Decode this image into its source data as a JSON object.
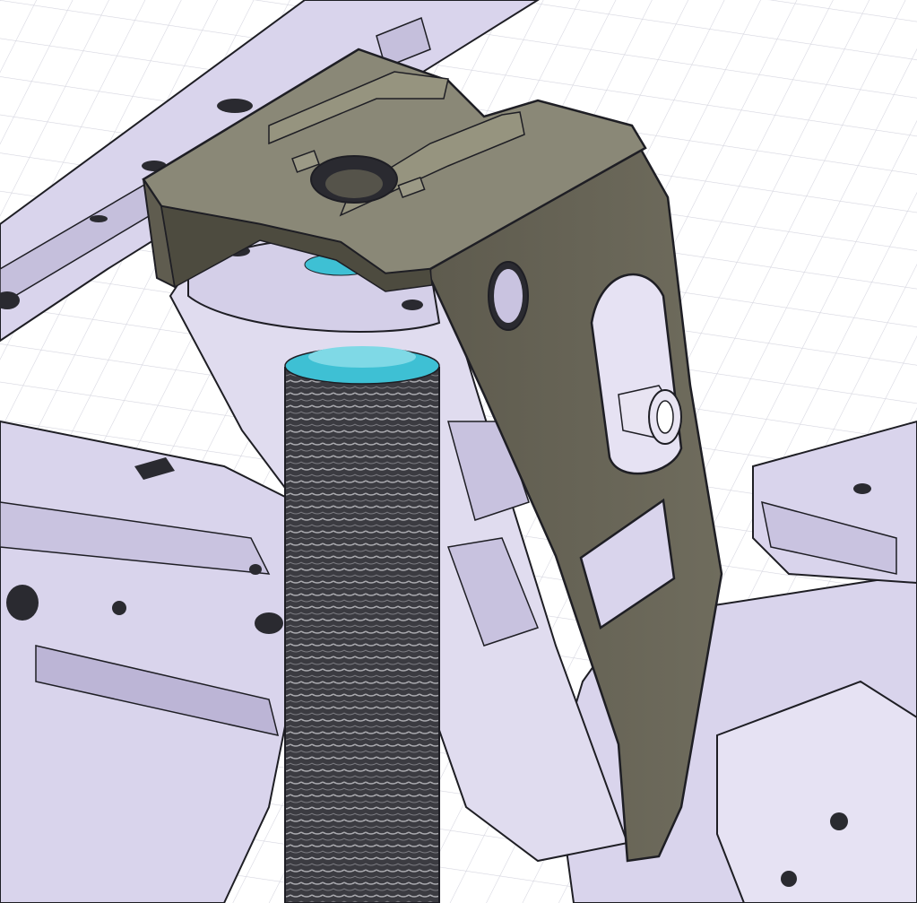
{
  "scene": {
    "description_visible_text": "",
    "colors": {
      "background": "#ffffff",
      "grid": "#d4d4de",
      "frame_fill": "#d9d4ec",
      "frame_shadow": "#b7b0d0",
      "frame_edge": "#1e1e24",
      "bracket_fill": "#6b6859",
      "bracket_top": "#8a8877",
      "bracket_dark": "#4d4b3f",
      "spring_fill": "#3b3b41",
      "spring_line": "#a9a9ae",
      "spring_seat": "#3ec0d4",
      "bolt_fill": "#e8e4f2"
    },
    "parts": [
      "frame-rail-upper",
      "frame-rail-lower",
      "shock-tower",
      "mount-bracket",
      "coil-spring",
      "spring-seat",
      "bushing-bolt"
    ]
  }
}
